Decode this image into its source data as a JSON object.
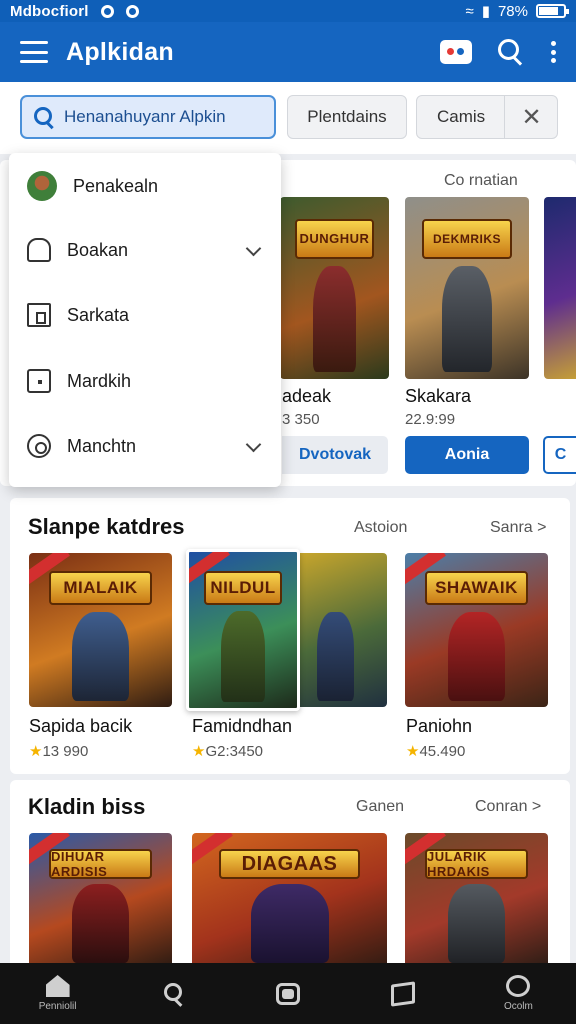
{
  "status_bar": {
    "carrier": "Mdbocfiorl",
    "battery_text": "78%",
    "battery_level": 0.78
  },
  "app_bar": {
    "title": "Aplkidan",
    "icons": [
      "menu-icon",
      "chat-icon",
      "search-icon",
      "more-vert-icon"
    ]
  },
  "search": {
    "value": "Henanahuyanr Alpkin",
    "chips": [
      "Plentdains",
      "Camis"
    ],
    "clear_icon": "close-icon"
  },
  "dropdown": {
    "items": [
      {
        "label": "Penakealn",
        "icon": "avatar-icon",
        "has_chevron": false
      },
      {
        "label": "Boakan",
        "icon": "bell-icon",
        "has_chevron": true
      },
      {
        "label": "Sarkata",
        "icon": "bag-icon",
        "has_chevron": false
      },
      {
        "label": "Mardkih",
        "icon": "box-icon",
        "has_chevron": false
      },
      {
        "label": "Manchtn",
        "icon": "gear-icon",
        "has_chevron": true
      }
    ]
  },
  "featured": {
    "header_link": "Co rnatian",
    "games": [
      {
        "title": "adeak",
        "price": "3 350",
        "banner": "DUNGHUR",
        "button": "Dvotovak"
      },
      {
        "title": "Skakara",
        "price": "22.9:99",
        "banner": "DEKMRIKS",
        "button": "Aoniа"
      }
    ],
    "peek_button": "C"
  },
  "section1": {
    "title": "Slanpe katdres",
    "link1": "Astoion",
    "link2": "Sanra >",
    "games": [
      {
        "title": "Sapida bacik",
        "rating": "13 990",
        "banner": "MIALAIK"
      },
      {
        "title": "Famidndhan",
        "rating": "G2:3450",
        "banner": "NILDUL"
      },
      {
        "title": "Paniohn",
        "rating": "45.490",
        "banner": "SHAWAIK"
      }
    ]
  },
  "section2": {
    "title": "Kladin biss",
    "link1": "Ganen",
    "link2": "Conran >",
    "games": [
      {
        "banner": "DIHUAR ARDISIS"
      },
      {
        "banner": "DIAGAAS"
      },
      {
        "banner": "JULARIK HRDAKIS"
      }
    ]
  },
  "bottom_nav": [
    {
      "label": "Penniolil",
      "icon": "home-icon"
    },
    {
      "label": "",
      "icon": "search-icon"
    },
    {
      "label": "",
      "icon": "apps-icon"
    },
    {
      "label": "",
      "icon": "library-icon"
    },
    {
      "label": "Ocolm",
      "icon": "profile-icon"
    }
  ]
}
